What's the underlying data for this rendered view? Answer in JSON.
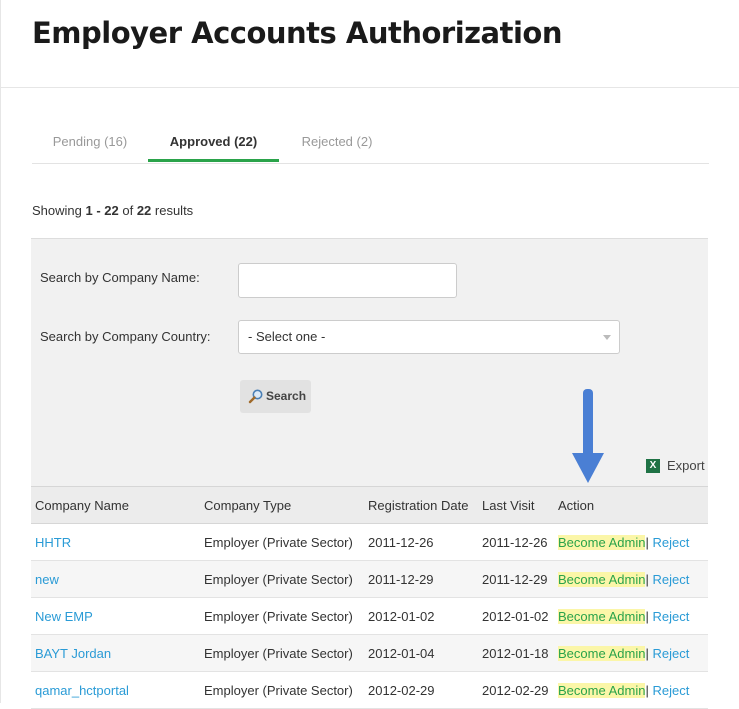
{
  "page": {
    "title": "Employer Accounts Authorization"
  },
  "tabs": [
    {
      "label": "Pending (16)"
    },
    {
      "label": "Approved (22)"
    },
    {
      "label": "Rejected (2)"
    }
  ],
  "results": {
    "prefix": "Showing ",
    "range": "1 - 22",
    "mid": " of ",
    "total": "22",
    "suffix": " results"
  },
  "search": {
    "company_name_label": "Search by Company Name:",
    "company_name_value": "",
    "country_label": "Search by Company Country:",
    "country_selected": "- Select one -",
    "button_label": "Search"
  },
  "export": {
    "label": "Export",
    "icon": "excel-icon",
    "icon_letter": "X"
  },
  "table": {
    "headers": [
      "Company Name",
      "Company Type",
      "Registration Date",
      "Last Visit",
      "Action"
    ],
    "rows": [
      {
        "name": "HHTR",
        "type": "Employer (Private Sector)",
        "registered": "2011-12-26",
        "last_visit": "2011-12-26",
        "action_primary": "Become Admin",
        "action_separator": "|",
        "action_secondary": "Reject"
      },
      {
        "name": "new",
        "type": "Employer (Private Sector)",
        "registered": "2011-12-29",
        "last_visit": "2011-12-29",
        "action_primary": "Become Admin",
        "action_separator": "|",
        "action_secondary": "Reject"
      },
      {
        "name": "New EMP",
        "type": "Employer (Private Sector)",
        "registered": "2012-01-02",
        "last_visit": "2012-01-02",
        "action_primary": "Become Admin",
        "action_separator": "|",
        "action_secondary": "Reject"
      },
      {
        "name": "BAYT Jordan",
        "type": "Employer (Private Sector)",
        "registered": "2012-01-04",
        "last_visit": "2012-01-18",
        "action_primary": "Become Admin",
        "action_separator": "|",
        "action_secondary": "Reject"
      },
      {
        "name": "qamar_hctportal",
        "type": "Employer (Private Sector)",
        "registered": "2012-02-29",
        "last_visit": "2012-02-29",
        "action_primary": "Become Admin",
        "action_separator": "|",
        "action_secondary": "Reject"
      }
    ]
  },
  "colors": {
    "accent_green": "#2aa34a",
    "link_blue": "#2a9bd6",
    "highlight_yellow": "#fbf6a8",
    "annotation_arrow": "#4a7fd4"
  }
}
